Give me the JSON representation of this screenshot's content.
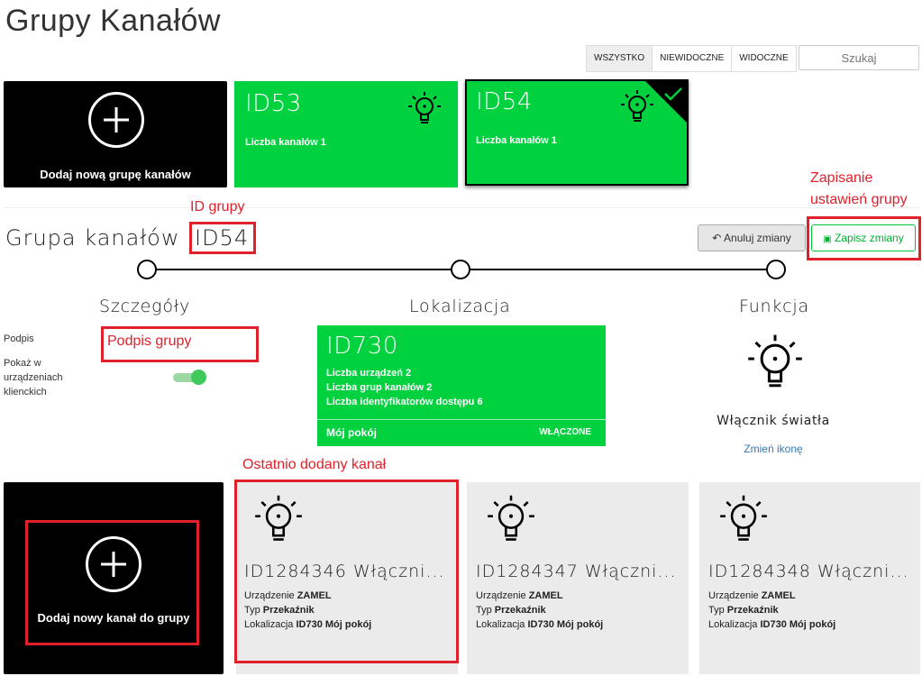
{
  "page_title": "Grupy Kanałów",
  "filters": [
    "WSZYSTKO",
    "NIEWIDOCZNE",
    "WIDOCZNE"
  ],
  "search": {
    "placeholder": "Szukaj"
  },
  "add_group_card": {
    "label": "Dodaj nową grupę kanałów"
  },
  "group_cards": [
    {
      "id": "ID53",
      "channels_label": "Liczba kanałów",
      "channels_count": "1"
    },
    {
      "id": "ID54",
      "channels_label": "Liczba kanałów",
      "channels_count": "1"
    }
  ],
  "annotations": {
    "save_settings_line1": "Zapisanie",
    "save_settings_line2": "ustawień grupy",
    "group_id": "ID grupy",
    "group_caption": "Podpis grupy",
    "last_added": "Ostatnio dodany kanał"
  },
  "section": {
    "title": "Grupa kanałów",
    "id": "ID54",
    "cancel_label": "Anuluj zmiany",
    "save_label": "Zapisz zmiany"
  },
  "steps": [
    "Szczegóły",
    "Lokalizacja",
    "Funkcja"
  ],
  "details": {
    "caption_label": "Podpis",
    "show_label": "Pokaż w urządzeniach klienckich"
  },
  "location": {
    "id": "ID730",
    "devices_label": "Liczba urządzeń",
    "devices": "2",
    "groups_label": "Liczba grup kanałów",
    "groups": "2",
    "access_label": "Liczba identyfikatorów dostępu",
    "access": "6",
    "name": "Mój pokój",
    "status": "WŁĄCZONE"
  },
  "function": {
    "name": "Włącznik światła",
    "change_icon_label": "Zmień ikonę"
  },
  "add_channel_card": {
    "label": "Dodaj nowy kanał do grupy"
  },
  "channels": [
    {
      "title": "ID1284346 Włączni...",
      "device_label": "Urządzenie",
      "device": "ZAMEL",
      "type_label": "Typ",
      "type": "Przekaźnik",
      "location_label": "Lokalizacja",
      "location": "ID730 Mój pokój"
    },
    {
      "title": "ID1284347 Włączni...",
      "device_label": "Urządzenie",
      "device": "ZAMEL",
      "type_label": "Typ",
      "type": "Przekaźnik",
      "location_label": "Lokalizacja",
      "location": "ID730 Mój pokój"
    },
    {
      "title": "ID1284348 Włączni...",
      "device_label": "Urządzenie",
      "device": "ZAMEL",
      "type_label": "Typ",
      "type": "Przekaźnik",
      "location_label": "Lokalizacja",
      "location": "ID730 Mój pokój"
    }
  ],
  "colors": {
    "green": "#00d13e",
    "annotation_red": "#e0202a",
    "link_blue": "#337ab7"
  }
}
